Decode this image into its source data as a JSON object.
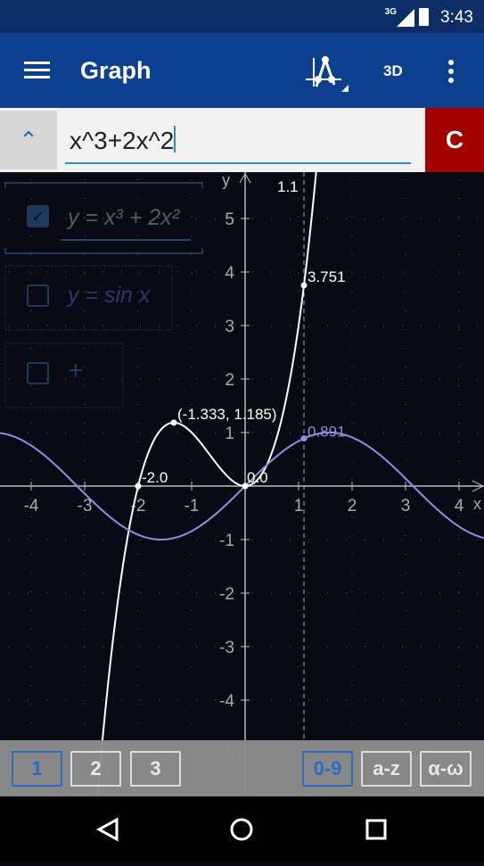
{
  "status": {
    "network": "3G",
    "time": "3:43"
  },
  "toolbar": {
    "title": "Graph",
    "three_d": "3D",
    "icons": [
      "menu-icon",
      "trace-icon",
      "more-vert-icon"
    ]
  },
  "input": {
    "value": "x^3+2x^2",
    "clear_label": "C",
    "collapse_icon": "chevron-up-icon"
  },
  "legend": {
    "items": [
      {
        "label": "y = x³ + 2x²",
        "checked": true
      },
      {
        "label": "y = sin x",
        "checked": false
      },
      {
        "label": "+",
        "checked": false
      }
    ]
  },
  "chart_data": {
    "type": "line",
    "xlim": [
      -4.6,
      4.5
    ],
    "ylim": [
      -5.3,
      5.8
    ],
    "grid": true,
    "x_ticks": [
      -4,
      -3,
      -2,
      -1,
      1,
      2,
      3,
      4
    ],
    "y_ticks": [
      -5,
      -4,
      -3,
      -2,
      -1,
      1,
      2,
      3,
      4,
      5
    ],
    "xlabel": "x",
    "ylabel": "y",
    "series": [
      {
        "expr": "x^3+2x^2",
        "color": "#ffffff"
      },
      {
        "expr": "sin(x)",
        "color": "#8f8fe0"
      }
    ],
    "trace_x": 1.1,
    "trace_label": "1.1",
    "points": [
      {
        "x": -2,
        "y": 0,
        "label": "-2.0"
      },
      {
        "x": -1.333,
        "y": 1.185,
        "label": "(-1.333, 1.185)"
      },
      {
        "x": 0,
        "y": 0,
        "label": "0.0"
      },
      {
        "x": 1.1,
        "y": 3.751,
        "label": "3.751"
      },
      {
        "x": 1.1,
        "y": 0.891,
        "label": "0.891",
        "series": 1
      }
    ]
  },
  "keyboard": {
    "pages": [
      "1",
      "2",
      "3"
    ],
    "modes": [
      "0-9",
      "a-z",
      "α-ω"
    ],
    "selected_page": "1",
    "selected_mode": "0-9"
  },
  "nav": {
    "icons": [
      "back-icon",
      "home-icon",
      "recents-icon"
    ]
  }
}
